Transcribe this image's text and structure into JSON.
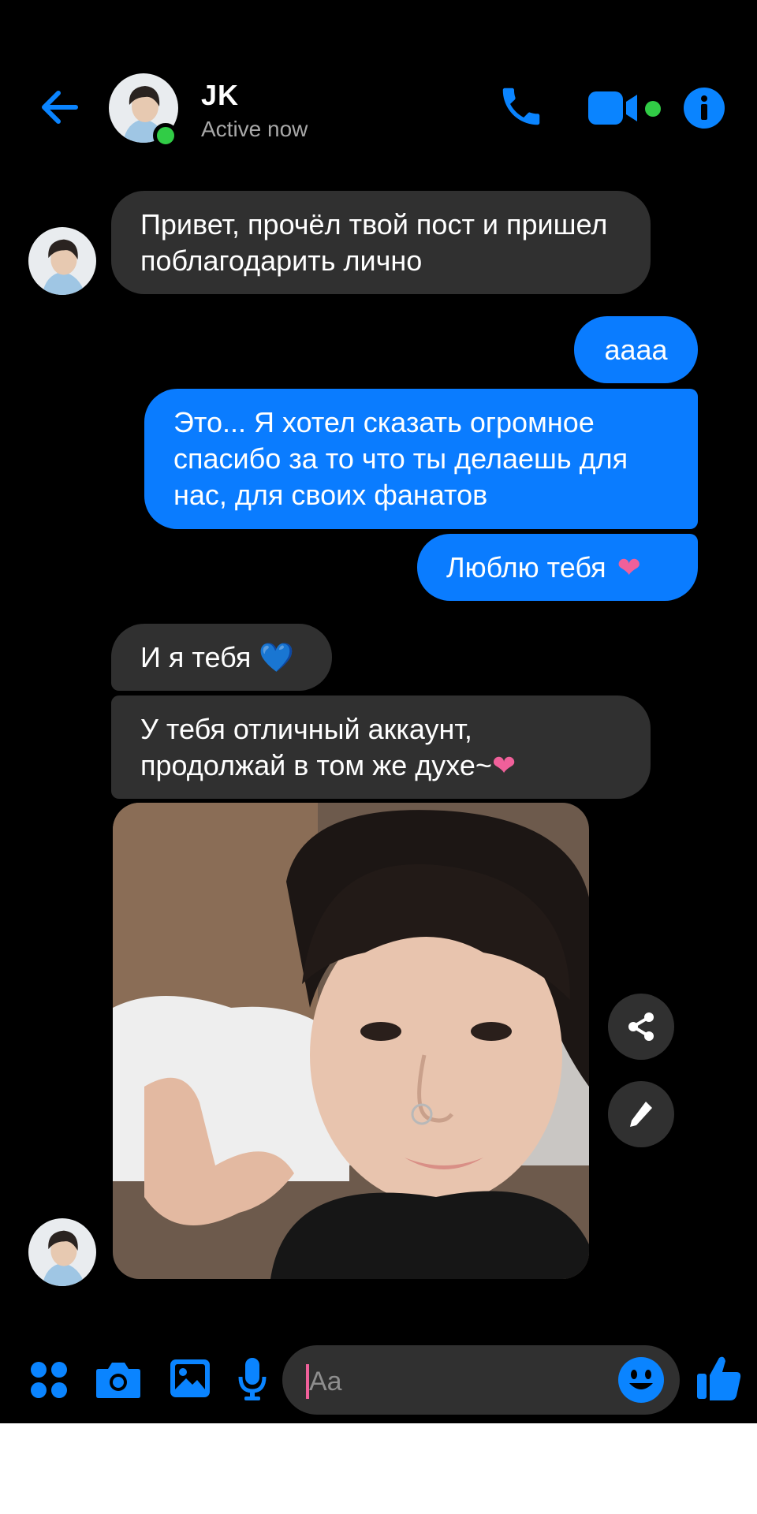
{
  "header": {
    "name": "JK",
    "status": "Active now"
  },
  "messages": [
    {
      "dir": "in",
      "text": "Привет, прочёл твой пост и пришел поблагодарить лично"
    },
    {
      "dir": "out",
      "text": "аааа"
    },
    {
      "dir": "out",
      "text": "Это... Я хотел сказать огромное спасибо за то что ты делаешь для нас, для своих фанатов"
    },
    {
      "dir": "out",
      "text": "Люблю тебя",
      "emoji": "❤"
    },
    {
      "dir": "in",
      "text": "И я тебя",
      "emoji": "💙"
    },
    {
      "dir": "in",
      "text": "У тебя отличный аккаунт, продолжай в том же духе~",
      "emoji": "❤"
    }
  ],
  "composer": {
    "placeholder": "Aa"
  },
  "icons": {
    "back": "arrow-left-icon",
    "call": "phone-icon",
    "video": "video-camera-icon",
    "info": "info-icon",
    "share": "share-icon",
    "edit": "pencil-icon",
    "menu": "four-dots-icon",
    "camera": "camera-icon",
    "gallery": "image-icon",
    "mic": "microphone-icon",
    "emoji": "smiley-icon",
    "like": "thumbs-up-icon"
  },
  "colors": {
    "accent": "#0a7cff",
    "online": "#31cc46",
    "incoming_bubble": "#303030",
    "background": "#000000"
  }
}
